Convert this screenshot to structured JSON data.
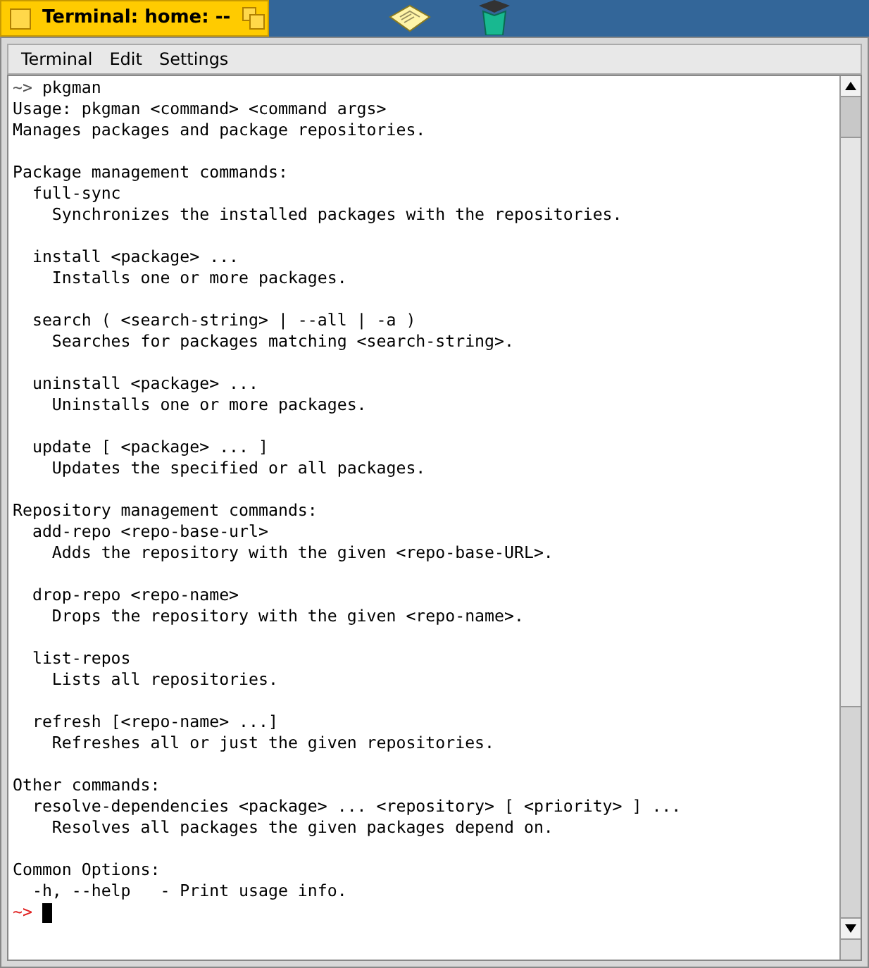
{
  "window": {
    "title": "Terminal: home: --"
  },
  "menu": [
    "Terminal",
    "Edit",
    "Settings"
  ],
  "terminal": {
    "lines": [
      {
        "kind": "prompt",
        "prompt": "~>",
        "color": "#555555",
        "text": "pkgman"
      },
      {
        "kind": "output",
        "text": "Usage: pkgman <command> <command args>"
      },
      {
        "kind": "output",
        "text": "Manages packages and package repositories."
      },
      {
        "kind": "blank"
      },
      {
        "kind": "output",
        "text": "Package management commands:"
      },
      {
        "kind": "output",
        "text": "  full-sync"
      },
      {
        "kind": "output",
        "text": "    Synchronizes the installed packages with the repositories."
      },
      {
        "kind": "blank"
      },
      {
        "kind": "output",
        "text": "  install <package> ..."
      },
      {
        "kind": "output",
        "text": "    Installs one or more packages."
      },
      {
        "kind": "blank"
      },
      {
        "kind": "output",
        "text": "  search ( <search-string> | --all | -a )"
      },
      {
        "kind": "output",
        "text": "    Searches for packages matching <search-string>."
      },
      {
        "kind": "blank"
      },
      {
        "kind": "output",
        "text": "  uninstall <package> ..."
      },
      {
        "kind": "output",
        "text": "    Uninstalls one or more packages."
      },
      {
        "kind": "blank"
      },
      {
        "kind": "output",
        "text": "  update [ <package> ... ]"
      },
      {
        "kind": "output",
        "text": "    Updates the specified or all packages."
      },
      {
        "kind": "blank"
      },
      {
        "kind": "output",
        "text": "Repository management commands:"
      },
      {
        "kind": "output",
        "text": "  add-repo <repo-base-url>"
      },
      {
        "kind": "output",
        "text": "    Adds the repository with the given <repo-base-URL>."
      },
      {
        "kind": "blank"
      },
      {
        "kind": "output",
        "text": "  drop-repo <repo-name>"
      },
      {
        "kind": "output",
        "text": "    Drops the repository with the given <repo-name>."
      },
      {
        "kind": "blank"
      },
      {
        "kind": "output",
        "text": "  list-repos"
      },
      {
        "kind": "output",
        "text": "    Lists all repositories."
      },
      {
        "kind": "blank"
      },
      {
        "kind": "output",
        "text": "  refresh [<repo-name> ...]"
      },
      {
        "kind": "output",
        "text": "    Refreshes all or just the given repositories."
      },
      {
        "kind": "blank"
      },
      {
        "kind": "output",
        "text": "Other commands:"
      },
      {
        "kind": "output",
        "text": "  resolve-dependencies <package> ... <repository> [ <priority> ] ..."
      },
      {
        "kind": "output",
        "text": "    Resolves all packages the given packages depend on."
      },
      {
        "kind": "blank"
      },
      {
        "kind": "output",
        "text": "Common Options:"
      },
      {
        "kind": "output",
        "text": "  -h, --help   - Print usage info."
      },
      {
        "kind": "prompt",
        "prompt": "~>",
        "color": "#e02020",
        "cursor": true
      }
    ]
  }
}
